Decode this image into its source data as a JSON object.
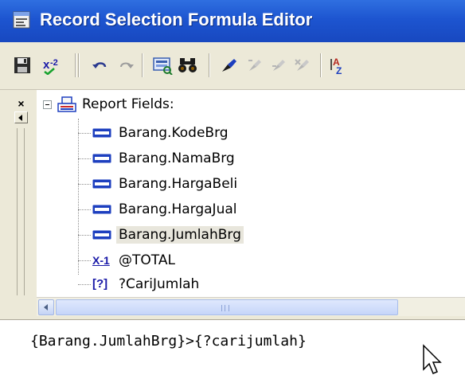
{
  "window": {
    "title": "Record Selection Formula Editor",
    "icon": "formula-editor-app-icon"
  },
  "toolbar": {
    "buttons": [
      {
        "name": "save-close-button",
        "icon": "save-icon"
      },
      {
        "name": "check-syntax-button",
        "icon": "check-formula-icon",
        "label": "x-2"
      },
      {
        "name": "undo-button",
        "icon": "undo-icon"
      },
      {
        "name": "redo-button",
        "icon": "redo-icon"
      },
      {
        "name": "browse-data-button",
        "icon": "browse-data-icon"
      },
      {
        "name": "find-button",
        "icon": "binoculars-icon"
      },
      {
        "name": "toggle-bookmark-button",
        "icon": "bookmark-icon"
      },
      {
        "name": "next-bookmark-button",
        "icon": "next-bookmark-icon"
      },
      {
        "name": "prev-bookmark-button",
        "icon": "prev-bookmark-icon"
      },
      {
        "name": "clear-bookmarks-button",
        "icon": "clear-bookmarks-icon"
      },
      {
        "name": "sort-button",
        "icon": "sort-az-icon"
      }
    ]
  },
  "tree": {
    "root": {
      "label": "Report Fields:",
      "icon": "report-fields-icon",
      "expanded": true
    },
    "children": [
      {
        "label": "Barang.KodeBrg",
        "icon": "database-field-icon"
      },
      {
        "label": "Barang.NamaBrg",
        "icon": "database-field-icon"
      },
      {
        "label": "Barang.HargaBeli",
        "icon": "database-field-icon"
      },
      {
        "label": "Barang.HargaJual",
        "icon": "database-field-icon"
      },
      {
        "label": "Barang.JumlahBrg",
        "icon": "database-field-icon",
        "selected": true
      },
      {
        "label": "@TOTAL",
        "icon": "formula-field-icon",
        "icon_text": "X-1"
      },
      {
        "label": "?CariJumlah",
        "icon": "parameter-field-icon",
        "icon_text": "[?]"
      }
    ]
  },
  "left_rail": {
    "close_glyph": "×"
  },
  "formula": {
    "text": "{Barang.JumlahBrg}>{?carijumlah}"
  },
  "colors": {
    "titlebar": "#1d55d0",
    "chrome": "#ece9d8",
    "field_icon": "#1d3fbf"
  }
}
